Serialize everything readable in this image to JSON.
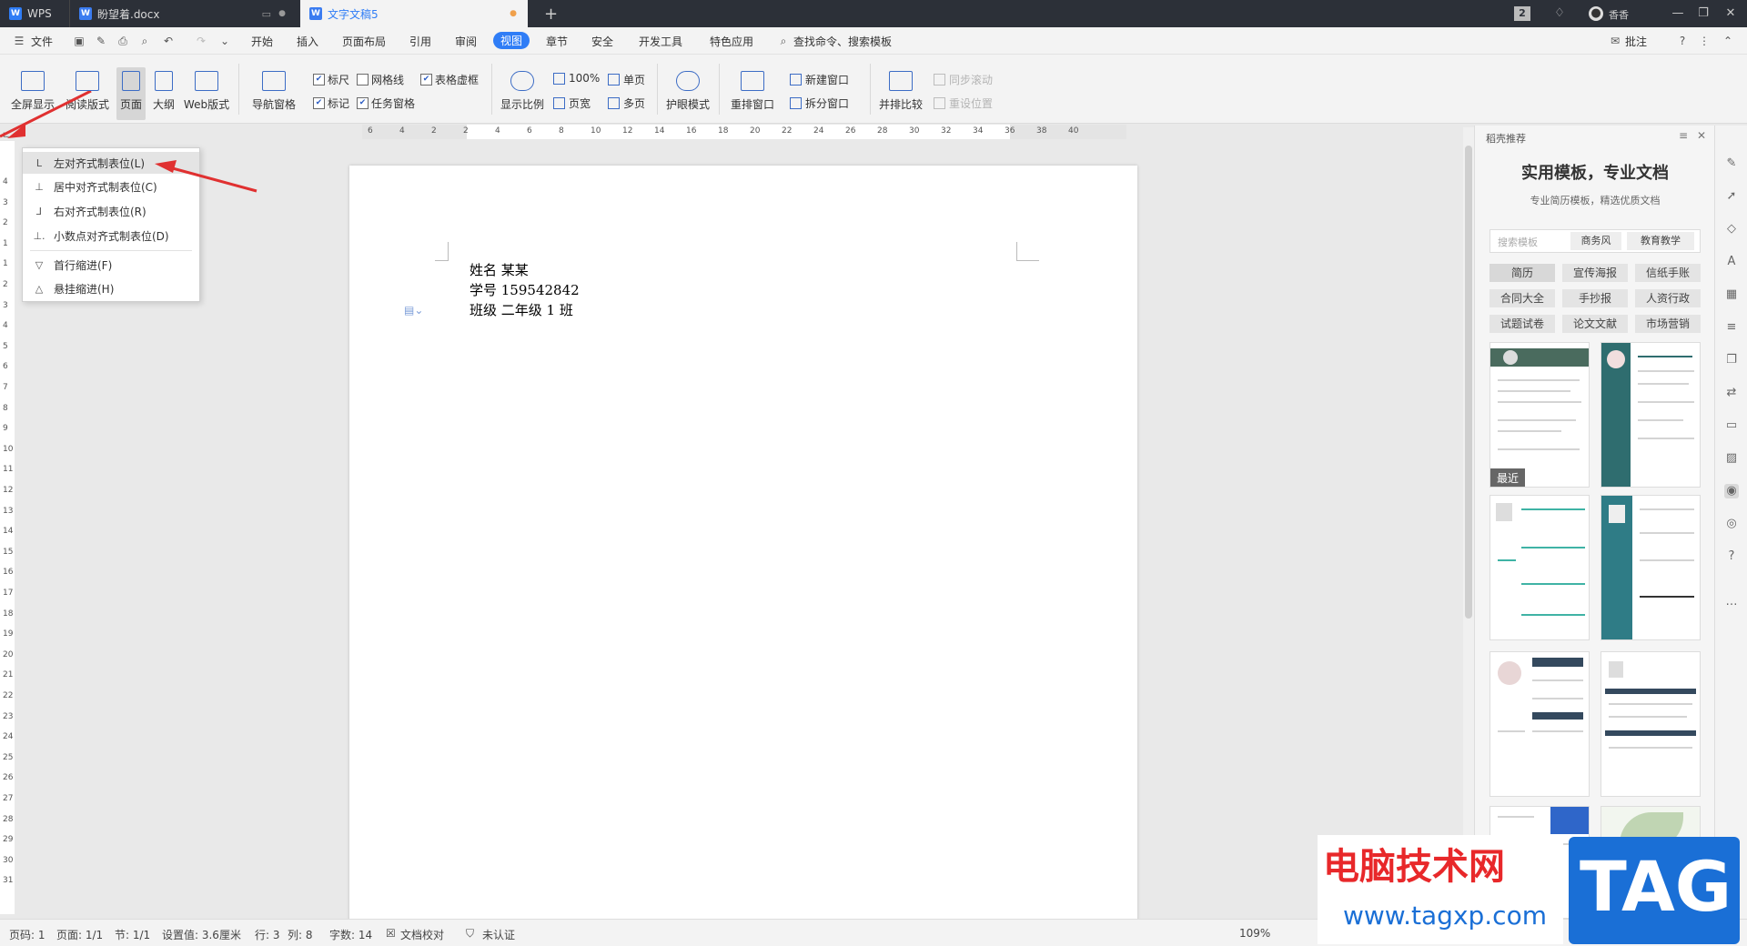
{
  "titlebar": {
    "app_label": "WPS",
    "tabs": [
      {
        "label": "盼望着.docx"
      },
      {
        "label": "文字文稿5"
      }
    ],
    "new_tab": "+",
    "badge": "2",
    "user": "香香"
  },
  "menubar": {
    "file": "文件",
    "items": [
      "开始",
      "插入",
      "页面布局",
      "引用",
      "审阅",
      "视图",
      "章节",
      "安全",
      "开发工具",
      "特色应用"
    ],
    "search": "查找命令、搜索模板",
    "comment": "批注"
  },
  "ribbon": {
    "fullscreen": "全屏显示",
    "reading": "阅读版式",
    "page": "页面",
    "outline": "大纲",
    "web": "Web版式",
    "nav_pane": "导航窗格",
    "ruler": "标尺",
    "gridlines": "网格线",
    "table_gridlines": "表格虚框",
    "marks": "标记",
    "task_pane": "任务窗格",
    "zoom": "显示比例",
    "zoom100": "100%",
    "page_width": "页宽",
    "single_page": "单页",
    "multi_page": "多页",
    "eye_care": "护眼模式",
    "rearrange": "重排窗口",
    "new_window": "新建窗口",
    "split_window": "拆分窗口",
    "side_by_side": "并排比较",
    "sync_scroll": "同步滚动",
    "reset_pos": "重设位置"
  },
  "ruler": {
    "h_ticks": [
      "6",
      "4",
      "2",
      "2",
      "4",
      "6",
      "8",
      "10",
      "12",
      "14",
      "16",
      "18",
      "20",
      "22",
      "24",
      "26",
      "28",
      "30",
      "32",
      "34",
      "36",
      "38",
      "40"
    ],
    "v_ticks": [
      "4",
      "3",
      "2",
      "1",
      "1",
      "2",
      "3",
      "4",
      "5",
      "6",
      "7",
      "8",
      "9",
      "10",
      "11",
      "12",
      "13",
      "14",
      "15",
      "16",
      "17",
      "18",
      "19",
      "20",
      "21",
      "22",
      "23",
      "24",
      "25",
      "26",
      "27",
      "28",
      "29",
      "30",
      "31"
    ]
  },
  "dropdown": {
    "items": [
      {
        "icon": "L",
        "label": "左对齐式制表位(L)"
      },
      {
        "icon": "⊥",
        "label": "居中对齐式制表位(C)"
      },
      {
        "icon": "⅃",
        "label": "右对齐式制表位(R)"
      },
      {
        "icon": "⊥.",
        "label": "小数点对齐式制表位(D)"
      },
      {
        "icon": "▽",
        "label": "首行缩进(F)"
      },
      {
        "icon": "△",
        "label": "悬挂缩进(H)"
      }
    ]
  },
  "document": {
    "lines": [
      "姓名  某某",
      "学号  159542842",
      "班级  二年级 1 班"
    ]
  },
  "panel": {
    "header": "稻壳推荐",
    "title": "实用模板，专业文档",
    "subtitle": "专业简历模板，精选优质文档",
    "search_placeholder": "搜索模板",
    "tabs": [
      "商务风",
      "教育教学"
    ],
    "tags": [
      "简历",
      "宣传海报",
      "信纸手账",
      "合同大全",
      "手抄报",
      "人资行政",
      "试题试卷",
      "论文文献",
      "市场营销"
    ],
    "recent_label": "最近"
  },
  "statusbar": {
    "page_code": "页码: 1",
    "page": "页面: 1/1",
    "section": "节: 1/1",
    "setting": "设置值: 3.6厘米",
    "row": "行: 3",
    "col": "列: 8",
    "words": "字数: 14",
    "proof": "文档校对",
    "cert": "未认证",
    "zoom": "109%"
  },
  "watermark": {
    "text": "电脑技术网",
    "url": "www.tagxp.com",
    "tag": "TAG"
  },
  "colors": {
    "accent": "#2f7df6",
    "arrow": "#e03030",
    "titlebar": "#2c3038",
    "watermark_red": "#e8282a",
    "watermark_blue": "#1a6fd6"
  }
}
